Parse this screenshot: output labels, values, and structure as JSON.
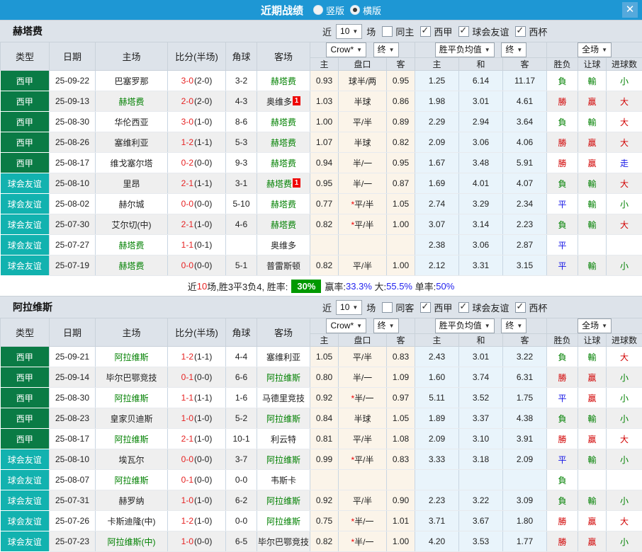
{
  "titlebar": {
    "title": "近期战绩",
    "radios": [
      {
        "label": "竖版",
        "selected": false
      },
      {
        "label": "横版",
        "selected": true
      }
    ],
    "close_label": "✕"
  },
  "colors": {
    "titlebar_blue": "#1e97d4",
    "league_green": "#0a7b45",
    "friendly_teal": "#12b2af",
    "win_red": "#d10000",
    "lose_green": "#008000",
    "draw_blue": "#1414e6",
    "score_red": "#e62222",
    "focal_team_green": "#008000",
    "summary_badge_green": "#009900",
    "crow_columns_bg": "#fbf4e9",
    "eu_columns_bg": "#e9f4fb"
  },
  "columns": {
    "type": "类型",
    "date": "日期",
    "home": "主场",
    "score": "比分(半场)",
    "corners": "角球",
    "away": "客场",
    "crow_home": "主",
    "crow_hcp": "盘口",
    "crow_away": "客",
    "eu_home": "主",
    "eu_draw": "和",
    "eu_away": "客",
    "result": "胜负",
    "handicap": "让球",
    "goals": "进球数"
  },
  "dropdowns": {
    "bookmaker": "Crow*",
    "final1": "终",
    "avg": "胜平负均值",
    "final2": "终",
    "scope": "全场",
    "games": "10"
  },
  "filter_labels": {
    "near": "近",
    "games": "场"
  },
  "sections": [
    {
      "team": "赫塔费",
      "same_label": "同主",
      "same_checked": false,
      "leagues": [
        {
          "label": "西甲",
          "checked": true
        },
        {
          "label": "球会友谊",
          "checked": true
        },
        {
          "label": "西杯",
          "checked": true
        }
      ],
      "rows": [
        {
          "type": "西甲",
          "tc": "league",
          "date": "25-09-22",
          "home": "巴塞罗那",
          "hf": false,
          "hb": "",
          "ft": "3-0",
          "ht": "(2-0)",
          "corners": "3-2",
          "away": "赫塔费",
          "af": true,
          "ab": "",
          "o1": "0.93",
          "star": false,
          "hcp": "球半/两",
          "o2": "0.95",
          "e1": "1.25",
          "e2": "6.14",
          "e3": "11.17",
          "res": "負",
          "resc": "g",
          "hres": "輸",
          "hresc": "g",
          "ou": "小",
          "ouc": "g"
        },
        {
          "type": "西甲",
          "tc": "league",
          "date": "25-09-13",
          "home": "赫塔费",
          "hf": true,
          "hb": "",
          "ft": "2-0",
          "ht": "(2-0)",
          "corners": "4-3",
          "away": "奥维多",
          "af": false,
          "ab": "1",
          "o1": "1.03",
          "star": false,
          "hcp": "半球",
          "o2": "0.86",
          "e1": "1.98",
          "e2": "3.01",
          "e3": "4.61",
          "res": "勝",
          "resc": "r",
          "hres": "贏",
          "hresc": "r",
          "ou": "大",
          "ouc": "r"
        },
        {
          "type": "西甲",
          "tc": "league",
          "date": "25-08-30",
          "home": "华伦西亚",
          "hf": false,
          "hb": "",
          "ft": "3-0",
          "ht": "(1-0)",
          "corners": "8-6",
          "away": "赫塔费",
          "af": true,
          "ab": "",
          "o1": "1.00",
          "star": false,
          "hcp": "平/半",
          "o2": "0.89",
          "e1": "2.29",
          "e2": "2.94",
          "e3": "3.64",
          "res": "負",
          "resc": "g",
          "hres": "輸",
          "hresc": "g",
          "ou": "大",
          "ouc": "r"
        },
        {
          "type": "西甲",
          "tc": "league",
          "date": "25-08-26",
          "home": "塞维利亚",
          "hf": false,
          "hb": "",
          "ft": "1-2",
          "ht": "(1-1)",
          "corners": "5-3",
          "away": "赫塔费",
          "af": true,
          "ab": "",
          "o1": "1.07",
          "star": false,
          "hcp": "半球",
          "o2": "0.82",
          "e1": "2.09",
          "e2": "3.06",
          "e3": "4.06",
          "res": "勝",
          "resc": "r",
          "hres": "贏",
          "hresc": "r",
          "ou": "大",
          "ouc": "r"
        },
        {
          "type": "西甲",
          "tc": "league",
          "date": "25-08-17",
          "home": "维戈塞尔塔",
          "hf": false,
          "hb": "",
          "ft": "0-2",
          "ht": "(0-0)",
          "corners": "9-3",
          "away": "赫塔费",
          "af": true,
          "ab": "",
          "o1": "0.94",
          "star": false,
          "hcp": "半/一",
          "o2": "0.95",
          "e1": "1.67",
          "e2": "3.48",
          "e3": "5.91",
          "res": "勝",
          "resc": "r",
          "hres": "贏",
          "hresc": "r",
          "ou": "走",
          "ouc": "b"
        },
        {
          "type": "球会友谊",
          "tc": "friendly",
          "date": "25-08-10",
          "home": "里昂",
          "hf": false,
          "hb": "",
          "ft": "2-1",
          "ht": "(1-1)",
          "corners": "3-1",
          "away": "赫塔费",
          "af": true,
          "ab": "1",
          "o1": "0.95",
          "star": false,
          "hcp": "半/一",
          "o2": "0.87",
          "e1": "1.69",
          "e2": "4.01",
          "e3": "4.07",
          "res": "負",
          "resc": "g",
          "hres": "輸",
          "hresc": "g",
          "ou": "大",
          "ouc": "r"
        },
        {
          "type": "球会友谊",
          "tc": "friendly",
          "date": "25-08-02",
          "home": "赫尔城",
          "hf": false,
          "hb": "",
          "ft": "0-0",
          "ht": "(0-0)",
          "corners": "5-10",
          "away": "赫塔费",
          "af": true,
          "ab": "",
          "o1": "0.77",
          "star": true,
          "hcp": "平/半",
          "o2": "1.05",
          "e1": "2.74",
          "e2": "3.29",
          "e3": "2.34",
          "res": "平",
          "resc": "b",
          "hres": "輸",
          "hresc": "g",
          "ou": "小",
          "ouc": "g"
        },
        {
          "type": "球会友谊",
          "tc": "friendly",
          "date": "25-07-30",
          "home": "艾尔切(中)",
          "hf": false,
          "hb": "",
          "ft": "2-1",
          "ht": "(1-0)",
          "corners": "4-6",
          "away": "赫塔费",
          "af": true,
          "ab": "",
          "o1": "0.82",
          "star": true,
          "hcp": "平/半",
          "o2": "1.00",
          "e1": "3.07",
          "e2": "3.14",
          "e3": "2.23",
          "res": "負",
          "resc": "g",
          "hres": "輸",
          "hresc": "g",
          "ou": "大",
          "ouc": "r"
        },
        {
          "type": "球会友谊",
          "tc": "friendly",
          "date": "25-07-27",
          "home": "赫塔费",
          "hf": true,
          "hb": "",
          "ft": "1-1",
          "ht": "(0-1)",
          "corners": "",
          "away": "奥维多",
          "af": false,
          "ab": "",
          "o1": "",
          "star": false,
          "hcp": "",
          "o2": "",
          "e1": "2.38",
          "e2": "3.06",
          "e3": "2.87",
          "res": "平",
          "resc": "b",
          "hres": "",
          "hresc": "",
          "ou": "",
          "ouc": ""
        },
        {
          "type": "球会友谊",
          "tc": "friendly",
          "date": "25-07-19",
          "home": "赫塔费",
          "hf": true,
          "hb": "",
          "ft": "0-0",
          "ht": "(0-0)",
          "corners": "5-1",
          "away": "普雷斯顿",
          "af": false,
          "ab": "",
          "o1": "0.82",
          "star": false,
          "hcp": "平/半",
          "o2": "1.00",
          "e1": "2.12",
          "e2": "3.31",
          "e3": "3.15",
          "res": "平",
          "resc": "b",
          "hres": "輸",
          "hresc": "g",
          "ou": "小",
          "ouc": "g"
        }
      ],
      "summary": [
        {
          "t": "近",
          "s": "k"
        },
        {
          "t": "10",
          "s": "r"
        },
        {
          "t": "场,胜3平3负4, 胜率:",
          "s": "k"
        },
        {
          "t": "30%",
          "s": "badge30"
        },
        {
          "t": "赢率:",
          "s": "k"
        },
        {
          "t": "33.3%",
          "s": "b"
        },
        {
          "t": " 大:",
          "s": "k"
        },
        {
          "t": "55.5%",
          "s": "b"
        },
        {
          "t": " 单率:",
          "s": "k"
        },
        {
          "t": "50%",
          "s": "b"
        }
      ]
    },
    {
      "team": "阿拉维斯",
      "same_label": "同客",
      "same_checked": false,
      "leagues": [
        {
          "label": "西甲",
          "checked": true
        },
        {
          "label": "球会友谊",
          "checked": true
        },
        {
          "label": "西杯",
          "checked": true
        }
      ],
      "rows": [
        {
          "type": "西甲",
          "tc": "league",
          "date": "25-09-21",
          "home": "阿拉维斯",
          "hf": true,
          "hb": "",
          "ft": "1-2",
          "ht": "(1-1)",
          "corners": "4-4",
          "away": "塞维利亚",
          "af": false,
          "ab": "",
          "o1": "1.05",
          "star": false,
          "hcp": "平/半",
          "o2": "0.83",
          "e1": "2.43",
          "e2": "3.01",
          "e3": "3.22",
          "res": "負",
          "resc": "g",
          "hres": "輸",
          "hresc": "g",
          "ou": "大",
          "ouc": "r"
        },
        {
          "type": "西甲",
          "tc": "league",
          "date": "25-09-14",
          "home": "毕尔巴鄂竞技",
          "hf": false,
          "hb": "",
          "ft": "0-1",
          "ht": "(0-0)",
          "corners": "6-6",
          "away": "阿拉维斯",
          "af": true,
          "ab": "",
          "o1": "0.80",
          "star": false,
          "hcp": "半/一",
          "o2": "1.09",
          "e1": "1.60",
          "e2": "3.74",
          "e3": "6.31",
          "res": "勝",
          "resc": "r",
          "hres": "贏",
          "hresc": "r",
          "ou": "小",
          "ouc": "g"
        },
        {
          "type": "西甲",
          "tc": "league",
          "date": "25-08-30",
          "home": "阿拉维斯",
          "hf": true,
          "hb": "",
          "ft": "1-1",
          "ht": "(1-1)",
          "corners": "1-6",
          "away": "马德里竞技",
          "af": false,
          "ab": "",
          "o1": "0.92",
          "star": true,
          "hcp": "半/一",
          "o2": "0.97",
          "e1": "5.11",
          "e2": "3.52",
          "e3": "1.75",
          "res": "平",
          "resc": "b",
          "hres": "贏",
          "hresc": "r",
          "ou": "小",
          "ouc": "g"
        },
        {
          "type": "西甲",
          "tc": "league",
          "date": "25-08-23",
          "home": "皇家贝迪斯",
          "hf": false,
          "hb": "",
          "ft": "1-0",
          "ht": "(1-0)",
          "corners": "5-2",
          "away": "阿拉维斯",
          "af": true,
          "ab": "",
          "o1": "0.84",
          "star": false,
          "hcp": "半球",
          "o2": "1.05",
          "e1": "1.89",
          "e2": "3.37",
          "e3": "4.38",
          "res": "負",
          "resc": "g",
          "hres": "輸",
          "hresc": "g",
          "ou": "小",
          "ouc": "g"
        },
        {
          "type": "西甲",
          "tc": "league",
          "date": "25-08-17",
          "home": "阿拉维斯",
          "hf": true,
          "hb": "",
          "ft": "2-1",
          "ht": "(1-0)",
          "corners": "10-1",
          "away": "利云特",
          "af": false,
          "ab": "",
          "o1": "0.81",
          "star": false,
          "hcp": "平/半",
          "o2": "1.08",
          "e1": "2.09",
          "e2": "3.10",
          "e3": "3.91",
          "res": "勝",
          "resc": "r",
          "hres": "贏",
          "hresc": "r",
          "ou": "大",
          "ouc": "r"
        },
        {
          "type": "球会友谊",
          "tc": "friendly",
          "date": "25-08-10",
          "home": "埃瓦尔",
          "hf": false,
          "hb": "",
          "ft": "0-0",
          "ht": "(0-0)",
          "corners": "3-7",
          "away": "阿拉维斯",
          "af": true,
          "ab": "",
          "o1": "0.99",
          "star": true,
          "hcp": "平/半",
          "o2": "0.83",
          "e1": "3.33",
          "e2": "3.18",
          "e3": "2.09",
          "res": "平",
          "resc": "b",
          "hres": "輸",
          "hresc": "g",
          "ou": "小",
          "ouc": "g"
        },
        {
          "type": "球会友谊",
          "tc": "friendly",
          "date": "25-08-07",
          "home": "阿拉维斯",
          "hf": true,
          "hb": "",
          "ft": "0-1",
          "ht": "(0-0)",
          "corners": "0-0",
          "away": "韦斯卡",
          "af": false,
          "ab": "",
          "o1": "",
          "star": false,
          "hcp": "",
          "o2": "",
          "e1": "",
          "e2": "",
          "e3": "",
          "res": "負",
          "resc": "g",
          "hres": "",
          "hresc": "",
          "ou": "",
          "ouc": ""
        },
        {
          "type": "球会友谊",
          "tc": "friendly",
          "date": "25-07-31",
          "home": "赫罗纳",
          "hf": false,
          "hb": "",
          "ft": "1-0",
          "ht": "(1-0)",
          "corners": "6-2",
          "away": "阿拉维斯",
          "af": true,
          "ab": "",
          "o1": "0.92",
          "star": false,
          "hcp": "平/半",
          "o2": "0.90",
          "e1": "2.23",
          "e2": "3.22",
          "e3": "3.09",
          "res": "負",
          "resc": "g",
          "hres": "輸",
          "hresc": "g",
          "ou": "小",
          "ouc": "g"
        },
        {
          "type": "球会友谊",
          "tc": "friendly",
          "date": "25-07-26",
          "home": "卡斯迪隆(中)",
          "hf": false,
          "hb": "",
          "ft": "1-2",
          "ht": "(1-0)",
          "corners": "0-0",
          "away": "阿拉维斯",
          "af": true,
          "ab": "",
          "o1": "0.75",
          "star": true,
          "hcp": "半/一",
          "o2": "1.01",
          "e1": "3.71",
          "e2": "3.67",
          "e3": "1.80",
          "res": "勝",
          "resc": "r",
          "hres": "贏",
          "hresc": "r",
          "ou": "大",
          "ouc": "r"
        },
        {
          "type": "球会友谊",
          "tc": "friendly",
          "date": "25-07-23",
          "home": "阿拉维斯(中)",
          "hf": true,
          "hb": "",
          "ft": "1-0",
          "ht": "(0-0)",
          "corners": "6-5",
          "away": "毕尔巴鄂竞技",
          "af": false,
          "ab": "",
          "o1": "0.82",
          "star": true,
          "hcp": "半/一",
          "o2": "1.00",
          "e1": "4.20",
          "e2": "3.53",
          "e3": "1.77",
          "res": "勝",
          "resc": "r",
          "hres": "贏",
          "hresc": "r",
          "ou": "小",
          "ouc": "g"
        }
      ],
      "summary": []
    }
  ]
}
